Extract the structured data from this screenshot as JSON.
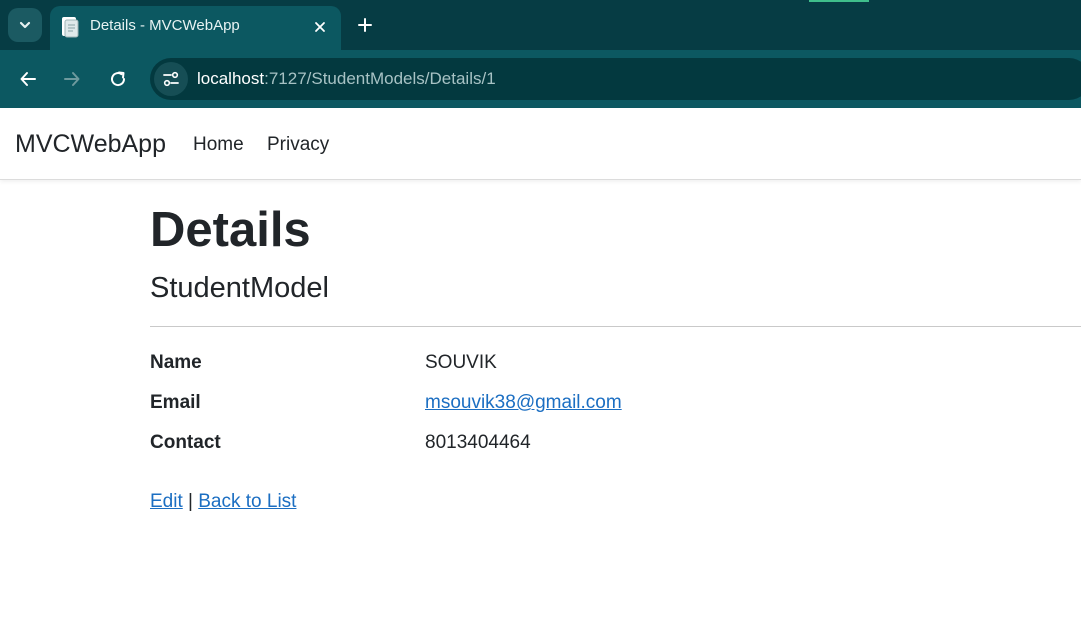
{
  "browser": {
    "tab": {
      "title": "Details - MVCWebApp"
    },
    "url": {
      "host": "localhost",
      "rest": ":7127/StudentModels/Details/1"
    },
    "icons": {
      "tab_search": "chevron-down-icon",
      "favicon": "document-icon",
      "close": "close-icon",
      "new_tab": "plus-icon",
      "back": "arrow-left-icon",
      "forward": "arrow-right-icon",
      "reload": "reload-icon",
      "site_info": "tune-icon"
    }
  },
  "navbar": {
    "brand": "MVCWebApp",
    "links": [
      "Home",
      "Privacy"
    ]
  },
  "page": {
    "heading": "Details",
    "subheading": "StudentModel",
    "fields": [
      {
        "label": "Name",
        "value": "SOUVIK"
      },
      {
        "label": "Email",
        "value": "msouvik38@gmail.com"
      },
      {
        "label": "Contact",
        "value": "8013404464"
      }
    ],
    "actions": {
      "edit": "Edit",
      "separator": "|",
      "back": "Back to List"
    }
  },
  "colors": {
    "chrome_dark": "#063c44",
    "chrome_teal": "#0c5861",
    "link": "#1b6ec2",
    "text": "#212529"
  }
}
